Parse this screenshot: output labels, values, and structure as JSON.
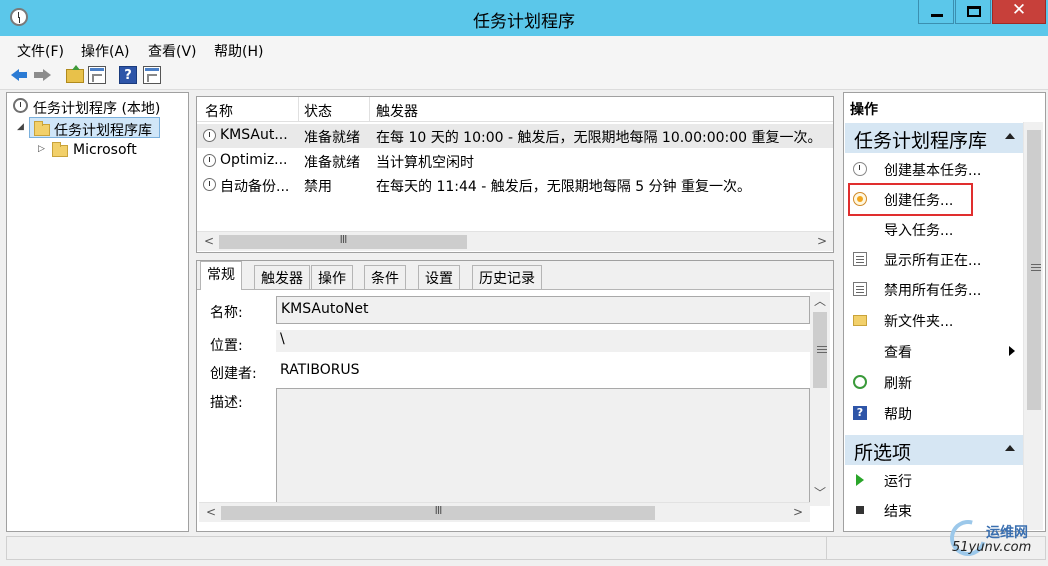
{
  "window": {
    "title": "任务计划程序",
    "controls": {
      "minimize": "─",
      "maximize": "□",
      "close": "✕"
    }
  },
  "menu": [
    "文件(F)",
    "操作(A)",
    "查看(V)",
    "帮助(H)"
  ],
  "toolbar": {
    "icons": [
      "back-icon",
      "forward-icon",
      "folder-up-icon",
      "show-hide-console-tree-icon",
      "help-icon",
      "show-hide-action-pane-icon"
    ],
    "help_glyph": "?"
  },
  "tree": {
    "root": "任务计划程序 (本地)",
    "library": "任务计划程序库",
    "child": "Microsoft",
    "expand_open": "◢",
    "expand_closed": "▷"
  },
  "task_list": {
    "columns": [
      "名称",
      "状态",
      "触发器"
    ],
    "rows": [
      {
        "name": "KMSAut...",
        "status": "准备就绪",
        "trigger": "在每 10 天的 10:00 - 触发后，无限期地每隔 10.00:00:00 重复一次。"
      },
      {
        "name": "Optimiz...",
        "status": "准备就绪",
        "trigger": "当计算机空闲时"
      },
      {
        "name": "自动备份...",
        "status": "禁用",
        "trigger": "在每天的 11:44 - 触发后，无限期地每隔 5 分钟 重复一次。"
      }
    ],
    "scroll_left": "<",
    "scroll_right": ">",
    "thumb_grip": "III"
  },
  "details": {
    "tabs": [
      "常规",
      "触发器",
      "操作",
      "条件",
      "设置",
      "历史记录"
    ],
    "active_tab": "常规",
    "name_label": "名称:",
    "name_value": "KMSAutoNet",
    "location_label": "位置:",
    "location_value": "\\",
    "author_label": "创建者:",
    "author_value": "RATIBORUS",
    "description_label": "描述:",
    "description_value": "",
    "scroll_up": "︿",
    "scroll_down": "﹀",
    "scroll_left": "<",
    "scroll_right": ">",
    "thumb_grip": "III"
  },
  "actions": {
    "header": "操作",
    "section1": {
      "title": "任务计划程序库",
      "items": [
        {
          "label": "创建基本任务...",
          "icon": "create-basic-task-icon"
        },
        {
          "label": "创建任务...",
          "icon": "create-task-icon"
        },
        {
          "label": "导入任务...",
          "icon": ""
        },
        {
          "label": "显示所有正在...",
          "icon": "running-tasks-icon"
        },
        {
          "label": "禁用所有任务...",
          "icon": "disable-history-icon"
        },
        {
          "label": "新文件夹...",
          "icon": "new-folder-icon"
        },
        {
          "label": "查看",
          "icon": ""
        },
        {
          "label": "刷新",
          "icon": "refresh-icon"
        },
        {
          "label": "帮助",
          "icon": "help-icon"
        }
      ]
    },
    "section2": {
      "title": "所选项",
      "items": [
        {
          "label": "运行",
          "icon": "run-icon"
        },
        {
          "label": "结束",
          "icon": "end-icon"
        }
      ]
    },
    "highlighted_item": "创建任务...",
    "help_glyph": "?"
  },
  "watermark": {
    "line1": "运维网",
    "line2": "51yunv.com"
  },
  "colors": {
    "titlebar": "#5bc7ea",
    "close_button": "#c7403a",
    "section_header": "#d6e6f3",
    "selection": "#d0e6f8",
    "highlight_box": "#e02e2e"
  }
}
